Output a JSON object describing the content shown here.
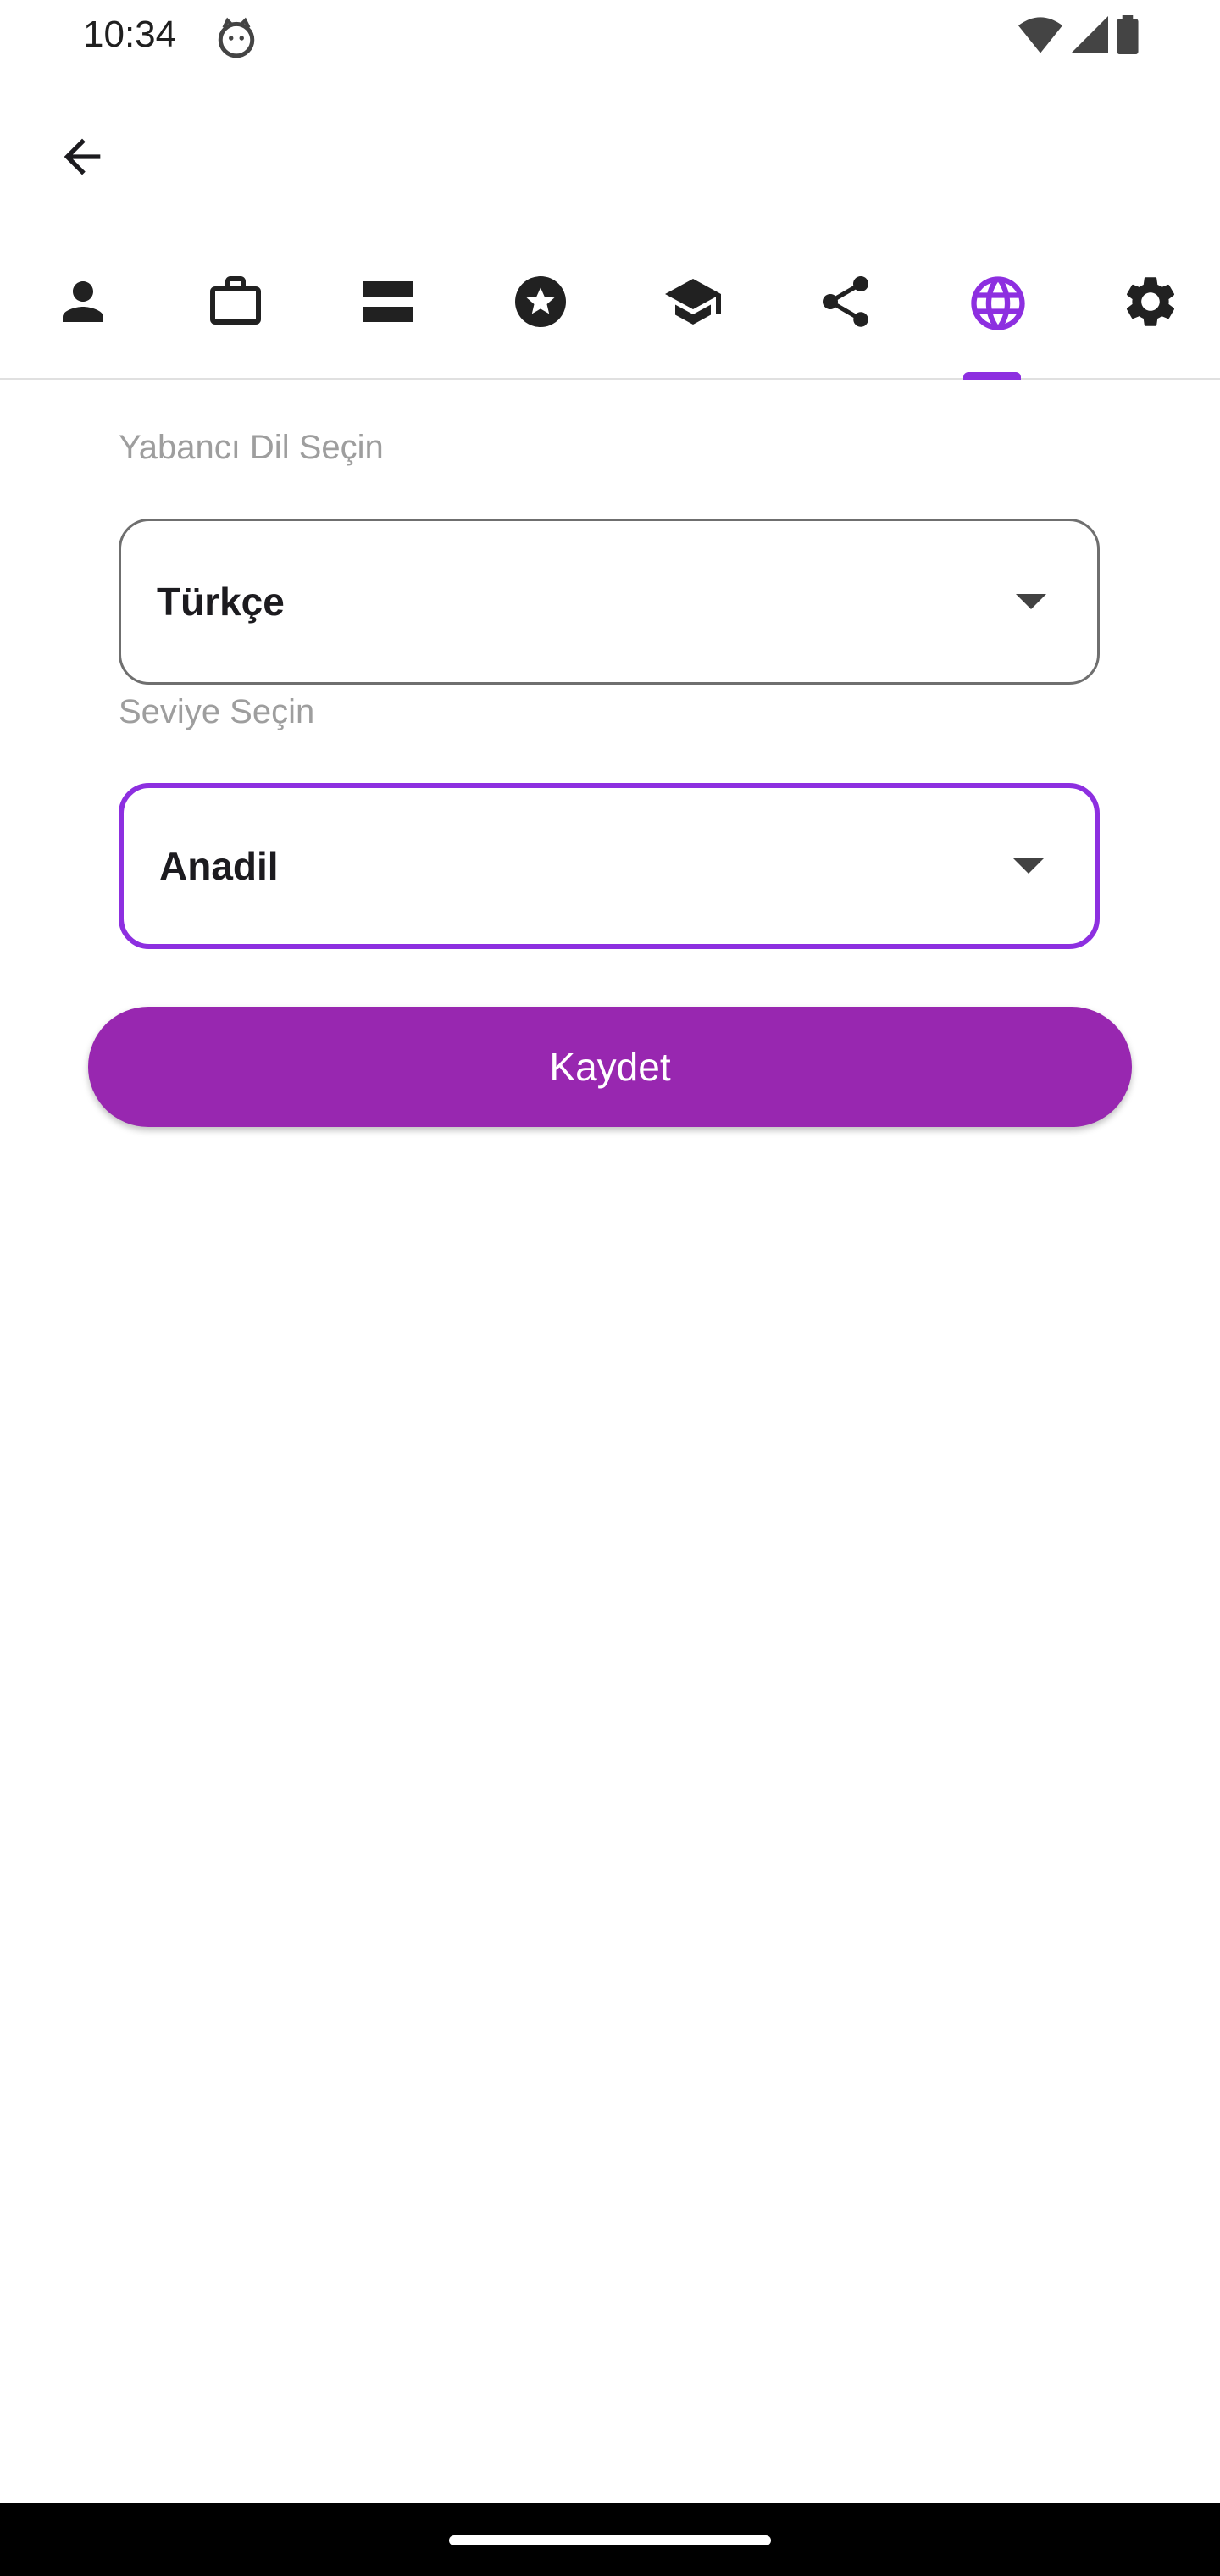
{
  "status_bar": {
    "time": "10:34",
    "icons": [
      "cat-icon",
      "wifi-icon",
      "signal-icon",
      "battery-icon"
    ]
  },
  "app_bar": {
    "back_icon": "arrow-back-icon"
  },
  "tabs": {
    "active_index": 6,
    "accent_color": "#8d2fe0",
    "items": [
      {
        "icon": "person-icon"
      },
      {
        "icon": "briefcase-icon"
      },
      {
        "icon": "storage-icon"
      },
      {
        "icon": "star-circle-icon"
      },
      {
        "icon": "school-icon"
      },
      {
        "icon": "share-icon"
      },
      {
        "icon": "language-globe-icon"
      },
      {
        "icon": "settings-gear-icon"
      }
    ]
  },
  "form": {
    "language_label": "Yabancı Dil Seçin",
    "language_value": "Türkçe",
    "level_label": "Seviye Seçin",
    "level_value": "Anadil",
    "save_label": "Kaydet",
    "button_color": "#9827b0"
  }
}
